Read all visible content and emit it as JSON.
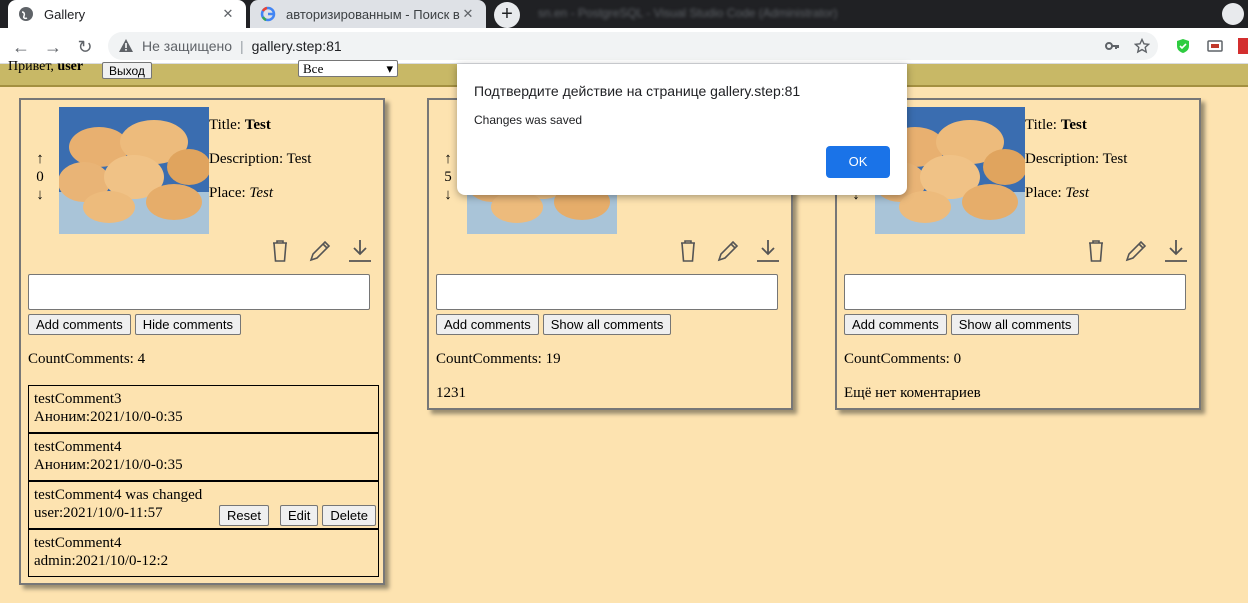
{
  "browser": {
    "tabs": [
      {
        "title": "Gallery"
      },
      {
        "title": "авторизированным - Поиск в G"
      }
    ],
    "blurred_tab_text": "sn.en - PostgreSQL - Visual Studio Code (Administrator)",
    "new_tab_label": "+",
    "tab_close": "✕",
    "address": {
      "security_label": "Не защищено",
      "separator": "|",
      "url": "gallery.step:81"
    }
  },
  "site_header": {
    "greeting": "Привет, ",
    "username": "user",
    "logout_label": "Выход",
    "sort_selected": "Все"
  },
  "cards": [
    {
      "votes": "0",
      "title_label": "Title: ",
      "title": "Test",
      "description_label": "Description: ",
      "description": "Test",
      "place_label": "Place: ",
      "place": "Test",
      "add_comments_label": "Add comments",
      "toggle_label": "Hide comments",
      "count_label": "CountComments: 4",
      "comments": [
        {
          "text": "testComment3",
          "meta": "Аноним:2021/10/0-0:35"
        },
        {
          "text": "testComment4",
          "meta": "Аноним:2021/10/0-0:35"
        },
        {
          "text": "testComment4 was changed",
          "meta": "user:2021/10/0-11:57",
          "reset_label": "Reset",
          "edit_label": "Edit",
          "delete_label": "Delete"
        },
        {
          "text": "testComment4",
          "meta": "admin:2021/10/0-12:2"
        }
      ]
    },
    {
      "votes": "5",
      "add_comments_label": "Add comments",
      "toggle_label": "Show all comments",
      "count_label": "CountComments: 19",
      "last_comment": "1231"
    },
    {
      "title_label": "Title: ",
      "title": "Test",
      "description_label": "Description: ",
      "description": "Test",
      "place_label": "Place: ",
      "place": "Test",
      "add_comments_label": "Add comments",
      "toggle_label": "Show all comments",
      "count_label": "CountComments: 0",
      "no_comments": "Ещё нет коментариев"
    }
  ],
  "vote_up": "↑",
  "vote_down": "↓",
  "dialog": {
    "title": "Подтвердите действие на странице gallery.step:81",
    "message": "Changes was saved",
    "ok_label": "OK",
    "ok_color": "#1a73e8"
  }
}
